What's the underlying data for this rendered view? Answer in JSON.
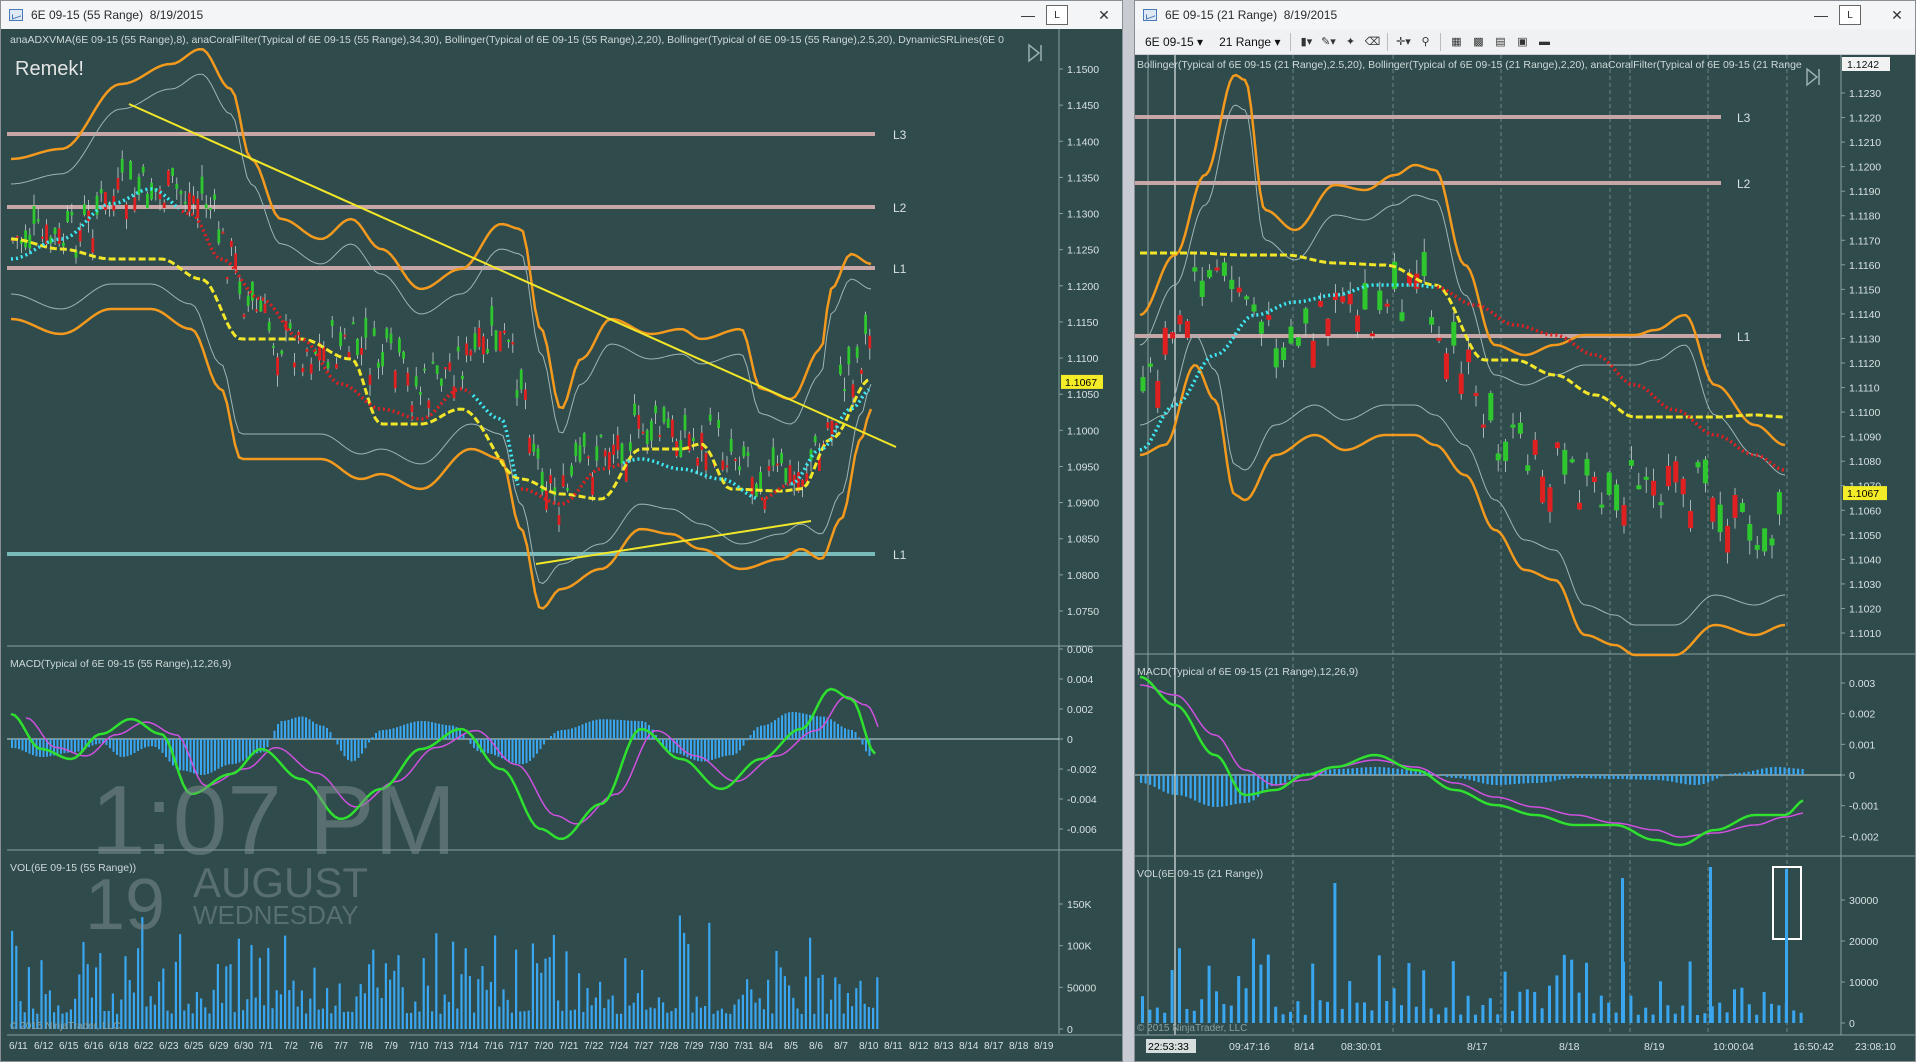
{
  "left": {
    "title": "6E 09-15 (55 Range)",
    "date": "8/19/2015",
    "indicator_header": "anaADXVMA(6E 09-15 (55 Range),8), anaCoralFilter(Typical of 6E 09-15 (55 Range),34,30), Bollinger(Typical of 6E 09-15 (55 Range),2,20), Bollinger(Typical of 6E 09-15 (55 Range),2.5,20), DynamicSRLines(6E 0",
    "remark": "Remek!",
    "price_ticks": [
      "1.1500",
      "1.1450",
      "1.1400",
      "1.1350",
      "1.1300",
      "1.1250",
      "1.1200",
      "1.1150",
      "1.1100",
      "1.1050",
      "1.1000",
      "1.0950",
      "1.0900",
      "1.0850",
      "1.0800",
      "1.0750"
    ],
    "price_label": "1.1067",
    "levels": [
      "L3",
      "L2",
      "L1",
      "L1"
    ],
    "macd_header": "MACD(Typical of 6E 09-15 (55 Range),12,26,9)",
    "macd_ticks": [
      "0.006",
      "0.004",
      "0.002",
      "0",
      "-0.002",
      "-0.004",
      "-0.006"
    ],
    "vol_header": "VOL(6E 09-15 (55 Range))",
    "vol_ticks": [
      "150K",
      "100K",
      "50000",
      "0"
    ],
    "copyright": "© 2015 NinjaTrader, LLC",
    "clock": {
      "time": "1:07 PM",
      "day": "19",
      "month": "AUGUST",
      "weekday": "WEDNESDAY"
    },
    "date_ticks": [
      "6/11",
      "6/12",
      "6/15",
      "6/16",
      "6/18",
      "6/22",
      "6/23",
      "6/25",
      "6/29",
      "6/30",
      "7/1",
      "7/2",
      "7/6",
      "7/7",
      "7/8",
      "7/9",
      "7/10",
      "7/13",
      "7/14",
      "7/16",
      "7/17",
      "7/20",
      "7/21",
      "7/22",
      "7/24",
      "7/27",
      "7/28",
      "7/29",
      "7/30",
      "7/31",
      "8/4",
      "8/5",
      "8/6",
      "8/7",
      "8/10",
      "8/11",
      "8/12",
      "8/13",
      "8/14",
      "8/17",
      "8/18",
      "8/19"
    ]
  },
  "right": {
    "title": "6E 09-15 (21 Range)",
    "date": "8/19/2015",
    "instrument": "6E 09-15",
    "interval": "21 Range",
    "indicator_header": "Bollinger(Typical of 6E 09-15 (21 Range),2.5,20), Bollinger(Typical of 6E 09-15 (21 Range),2,20), anaCoralFilter(Typical of 6E 09-15 (21 Range",
    "price_top": "1.1242",
    "price_ticks": [
      "1.1230",
      "1.1220",
      "1.1210",
      "1.1200",
      "1.1190",
      "1.1180",
      "1.1170",
      "1.1160",
      "1.1150",
      "1.1140",
      "1.1130",
      "1.1120",
      "1.1110",
      "1.1100",
      "1.1090",
      "1.1080",
      "1.1070",
      "1.1060",
      "1.1050",
      "1.1040",
      "1.1030",
      "1.1020",
      "1.1010"
    ],
    "price_label": "1.1067",
    "levels": [
      "L3",
      "L2",
      "L1"
    ],
    "macd_header": "MACD(Typical of 6E 09-15 (21 Range),12,26,9)",
    "macd_ticks": [
      "0.003",
      "0.002",
      "0.001",
      "0",
      "-0.001",
      "-0.002"
    ],
    "vol_header": "VOL(6E 09-15 (21 Range))",
    "vol_ticks": [
      "30000",
      "20000",
      "10000",
      "0"
    ],
    "copyright": "© 2015 NinjaTrader, LLC",
    "time_ticks": [
      "22:53:33",
      "09:47:16",
      "8/14",
      "08:30:01",
      "8/17",
      "8/18",
      "8/19",
      "10:00:04",
      "16:50:42",
      "23:08:10"
    ]
  },
  "colors": {
    "bg": "#2f4b4c",
    "orange": "#f39a1e",
    "yellow": "#f2e629",
    "cyan": "#3ee8f4",
    "red": "#e02020",
    "green": "#2ec82e",
    "blue": "#3aa6f0",
    "level": "#d7b0b0",
    "support": "#7fc8c8"
  }
}
